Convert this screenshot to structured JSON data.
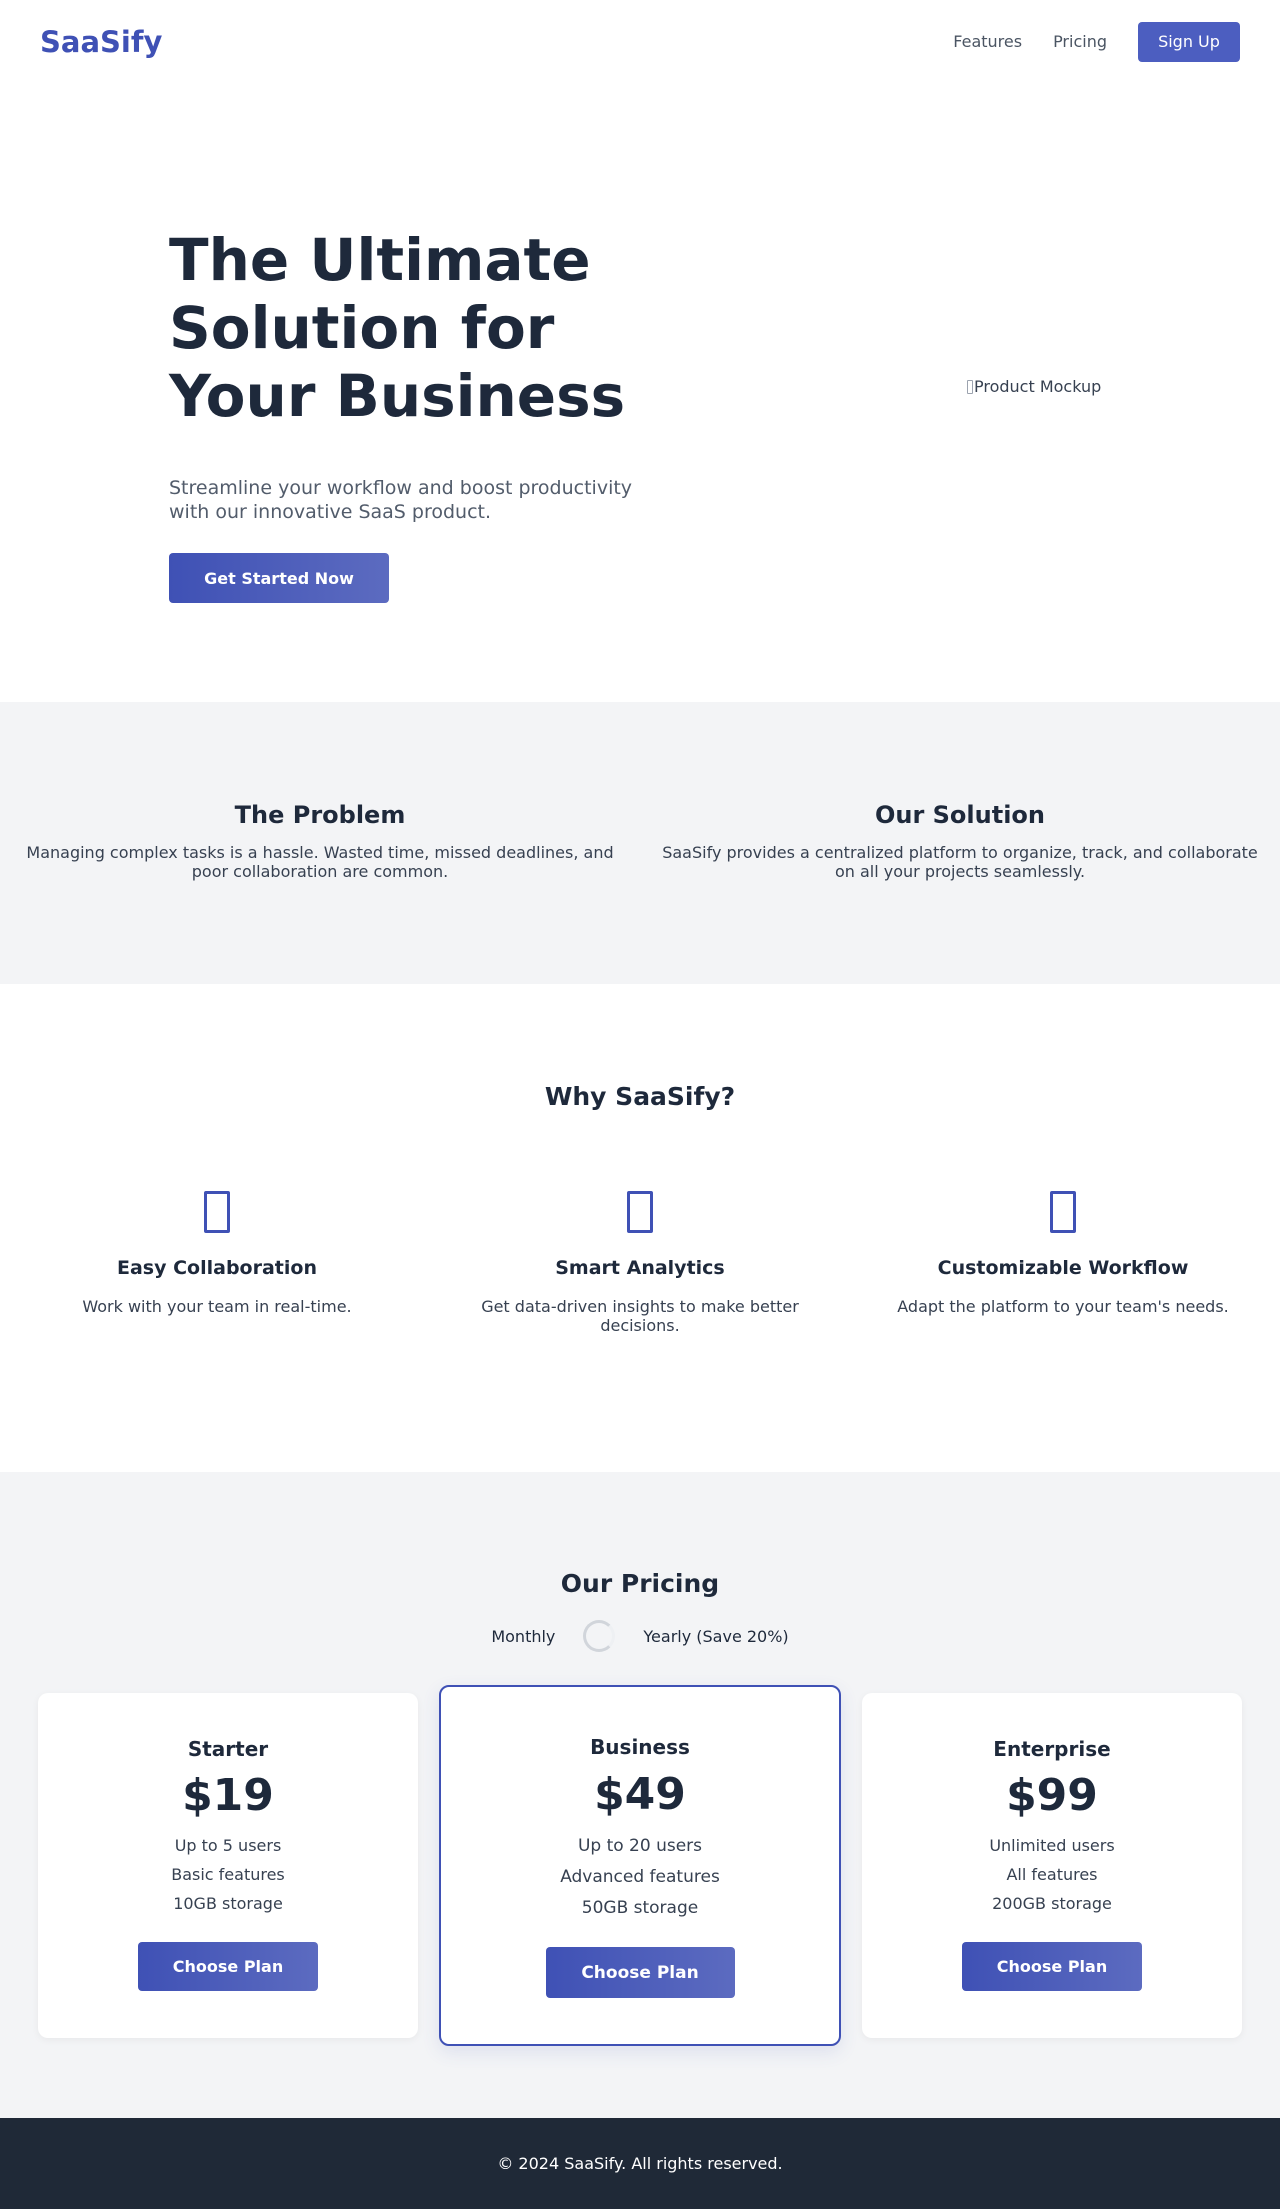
{
  "header": {
    "logo": "SaaSify",
    "nav": [
      "Features",
      "Pricing"
    ],
    "signup_label": "Sign Up"
  },
  "hero": {
    "title": "The Ultimate Solution for Your Business",
    "subtitle": "Streamline your workflow and boost productivity with our innovative SaaS product.",
    "cta_label": "Get Started Now",
    "image_alt": "Product Mockup"
  },
  "problem": {
    "title": "The Problem",
    "text": "Managing complex tasks is a hassle. Wasted time, missed deadlines, and poor collaboration are common."
  },
  "solution": {
    "title": "Our Solution",
    "text": "SaaSify provides a centralized platform to organize, track, and collaborate on all your projects seamlessly."
  },
  "features": {
    "title": "Why SaaSify?",
    "items": [
      {
        "icon": "collaboration-icon",
        "title": "Easy Collaboration",
        "text": "Work with your team in real-time."
      },
      {
        "icon": "analytics-icon",
        "title": "Smart Analytics",
        "text": "Get data-driven insights to make better decisions."
      },
      {
        "icon": "workflow-icon",
        "title": "Customizable Workflow",
        "text": "Adapt the platform to your team's needs."
      }
    ]
  },
  "pricing": {
    "title": "Our Pricing",
    "toggle": {
      "monthly_label": "Monthly",
      "yearly_label": "Yearly (Save 20%)"
    },
    "plans": [
      {
        "name": "Starter",
        "price": "$19",
        "features": [
          "Up to 5 users",
          "Basic features",
          "10GB storage"
        ],
        "button": "Choose Plan"
      },
      {
        "name": "Business",
        "price": "$49",
        "features": [
          "Up to 20 users",
          "Advanced features",
          "50GB storage"
        ],
        "button": "Choose Plan"
      },
      {
        "name": "Enterprise",
        "price": "$99",
        "features": [
          "Unlimited users",
          "All features",
          "200GB storage"
        ],
        "button": "Choose Plan"
      }
    ]
  },
  "footer": {
    "text": "© 2024 SaaSify. All rights reserved."
  },
  "colors": {
    "brand": "#3f51b5",
    "dark": "#1f2937",
    "light_bg": "#f3f4f6"
  }
}
